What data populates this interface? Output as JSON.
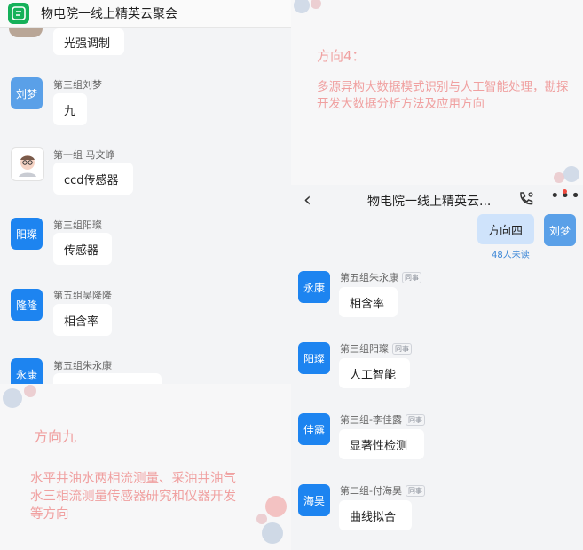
{
  "left_chat": {
    "title": "物电院一线上精英云聚会",
    "top_bubble": "光强调制",
    "messages": [
      {
        "avatar": "刘梦",
        "sender": "第三组刘梦",
        "text": "九"
      },
      {
        "avatar": "",
        "sender": "第一组 马文峥",
        "text": "ccd传感器"
      },
      {
        "avatar": "阳璨",
        "sender": "第三组阳璨",
        "text": "传感器"
      },
      {
        "avatar": "隆隆",
        "sender": "第五组吴隆隆",
        "text": "相含率"
      },
      {
        "avatar": "永康",
        "sender": "第五组朱永康",
        "text": ""
      }
    ]
  },
  "slide_top": {
    "heading": "方向4：",
    "body": "多源异构大数据模式识别与人工智能处理，勘探开发大数据分析方法及应用方向"
  },
  "right_chat": {
    "title": "物电院一线上精英云...",
    "back_icon": "back-chevron-icon",
    "self_message": {
      "text": "方向四",
      "avatar": "刘梦",
      "read_status": "48人未读"
    },
    "tag_label": "同事",
    "messages": [
      {
        "avatar": "永康",
        "sender": "第五组朱永康",
        "text": "相含率"
      },
      {
        "avatar": "阳璨",
        "sender": "第三组阳璨",
        "text": "人工智能"
      },
      {
        "avatar": "佳露",
        "sender": "第三组-李佳露",
        "text": "显著性检测"
      },
      {
        "avatar": "海昊",
        "sender": "第二组-付海昊",
        "text": "曲线拟合"
      }
    ]
  },
  "slide_bottom": {
    "heading": "方向九",
    "body": "水平井油水两相流测量、采油井油气水三相流测量传感器研究和仪器开发等方向"
  },
  "colors": {
    "accent": "#1d84f0",
    "app_green": "#16b15a",
    "slide_text": "#f0a0a0"
  }
}
